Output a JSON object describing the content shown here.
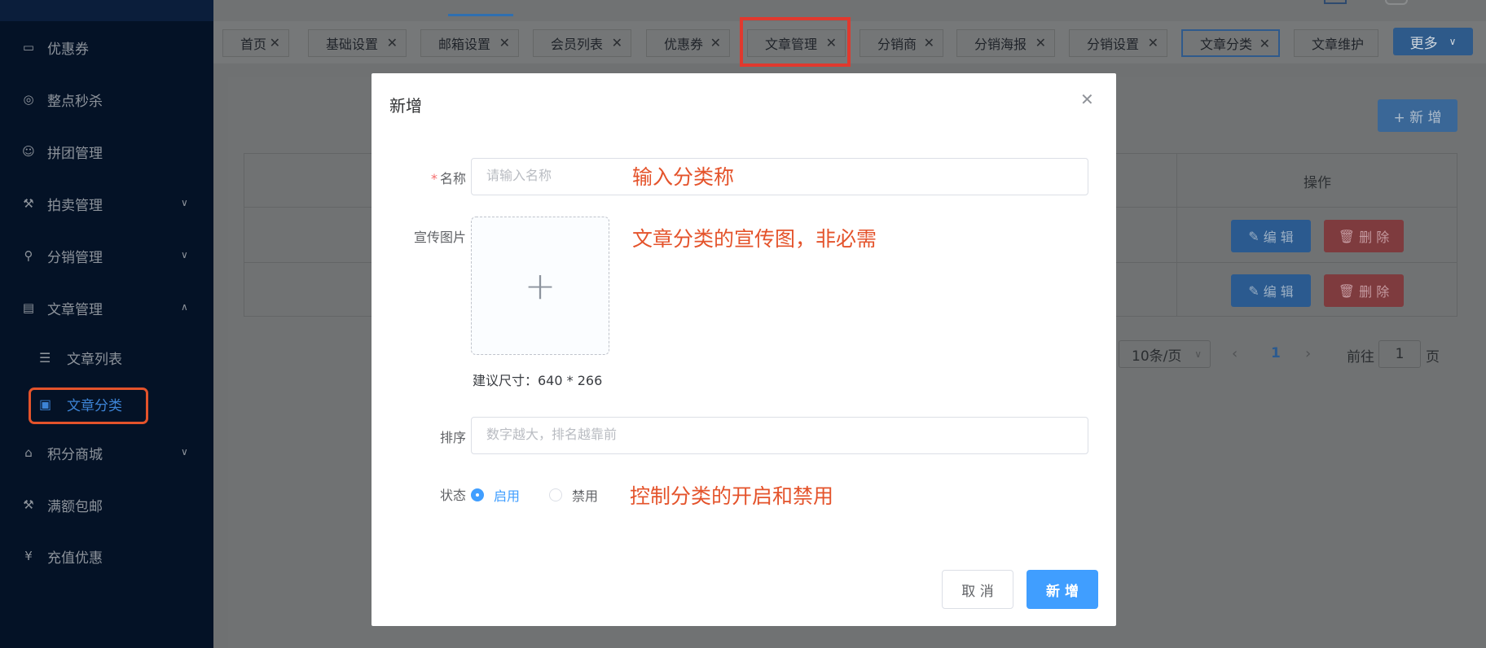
{
  "sidebar": {
    "items": [
      {
        "label": "优惠券",
        "icon": "coupon-icon"
      },
      {
        "label": "整点秒杀",
        "icon": "flash-sale-icon"
      },
      {
        "label": "拼团管理",
        "icon": "group-icon"
      },
      {
        "label": "拍卖管理",
        "icon": "gavel-icon"
      },
      {
        "label": "分销管理",
        "icon": "distribution-icon"
      },
      {
        "label": "文章管理",
        "icon": "document-icon"
      },
      {
        "label": "积分商城",
        "icon": "store-icon"
      },
      {
        "label": "满额包邮",
        "icon": "gavel-icon"
      },
      {
        "label": "充值优惠",
        "icon": "yen-icon"
      }
    ],
    "sub_items": [
      {
        "label": "文章列表",
        "icon": "list-icon"
      },
      {
        "label": "文章分类",
        "icon": "category-icon",
        "active": true
      }
    ]
  },
  "tabs": [
    {
      "label": "首页"
    },
    {
      "label": "基础设置"
    },
    {
      "label": "邮箱设置"
    },
    {
      "label": "会员列表"
    },
    {
      "label": "优惠券"
    },
    {
      "label": "文章管理"
    },
    {
      "label": "分销商"
    },
    {
      "label": "分销海报"
    },
    {
      "label": "分销设置"
    },
    {
      "label": "文章分类",
      "active": true
    },
    {
      "label": "文章维护"
    }
  ],
  "tabs_more_label": "更多",
  "background": {
    "add_label": "+ 新 增",
    "column_header": "操作",
    "edit_label": "编 辑",
    "delete_label": "删 除",
    "page_size": "10条/页",
    "current_page": "1",
    "goto_prefix": "前往",
    "goto_value": "1",
    "goto_suffix": "页"
  },
  "dialog": {
    "title": "新增",
    "close_icon": "close-icon",
    "name_label": "名称",
    "name_placeholder": "请输入名称",
    "image_label": "宣传图片",
    "size_hint": "建议尺寸：640 * 266",
    "sort_label": "排序",
    "sort_placeholder": "数字越大，排名越靠前",
    "status_label": "状态",
    "status_options": [
      {
        "label": "启用",
        "selected": true
      },
      {
        "label": "禁用",
        "selected": false
      }
    ],
    "cancel_label": "取 消",
    "submit_label": "新 增"
  },
  "annotations": {
    "name_note": "输入分类称",
    "image_note": "文章分类的宣传图，非必需",
    "status_note": "控制分类的开启和禁用"
  },
  "colors": {
    "primary": "#409eff",
    "annotation": "#e4532b",
    "sidebar_bg": "#041226"
  }
}
